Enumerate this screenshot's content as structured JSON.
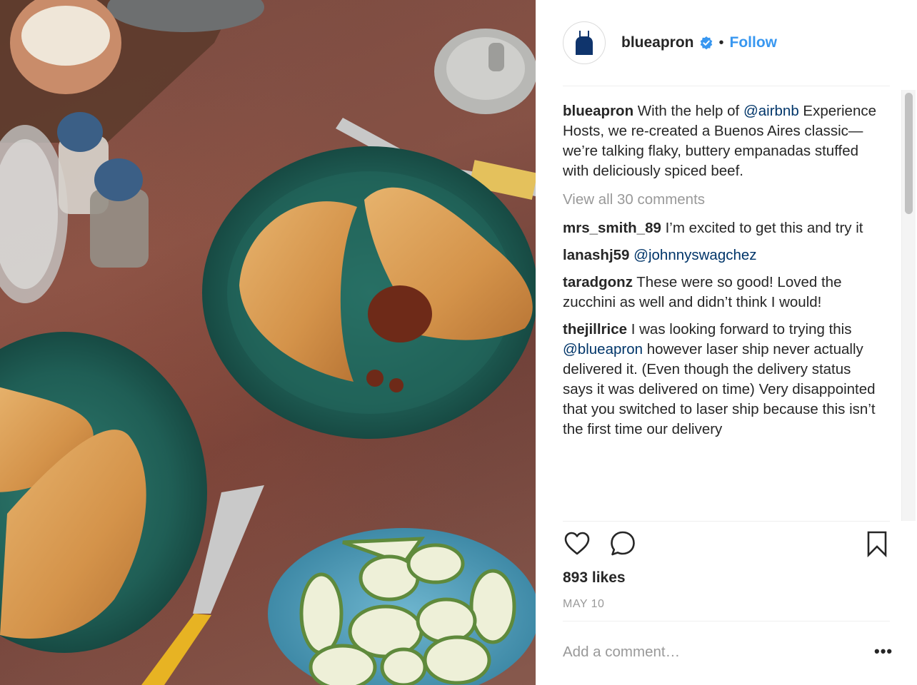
{
  "post": {
    "username": "blueapron",
    "verified": true,
    "follow_label": "Follow",
    "separator": "•",
    "caption": {
      "user": "blueapron",
      "before": "With the help of ",
      "mention": "@airbnb",
      "after": " Experience Hosts, we re-created a Buenos Aires classic—we’re talking flaky, buttery empanadas stuffed with deliciously spiced beef."
    },
    "view_all_label": "View all 30 comments",
    "comments": [
      {
        "user": "mrs_smith_89",
        "text": "I’m excited to get this and try it"
      },
      {
        "user": "lanashj59",
        "mention": "@johnnyswagchez"
      },
      {
        "user": "taradgonz",
        "text": "These were so good! Loved the zucchini as well and didn’t think I would!"
      },
      {
        "user": "thejillrice",
        "before": "I was looking forward to trying this ",
        "mention": "@blueapron",
        "after": " however laser ship never actually delivered it. (Even though the delivery status says it was delivered on time) Very disappointed that you switched to laser ship because this isn’t the first time our delivery"
      }
    ],
    "likes": "893 likes",
    "date": "MAY 10",
    "comment_placeholder": "Add a comment…",
    "more_label": "•••"
  },
  "icons": {
    "avatar": "apron-logo-icon",
    "verified": "verified-badge-icon",
    "like": "heart-icon",
    "comment": "comment-bubble-icon",
    "save": "bookmark-icon"
  },
  "colors": {
    "brand_blue": "#0f346c",
    "link_blue": "#3897f0",
    "mention_blue": "#003569",
    "muted_gray": "#999999"
  }
}
